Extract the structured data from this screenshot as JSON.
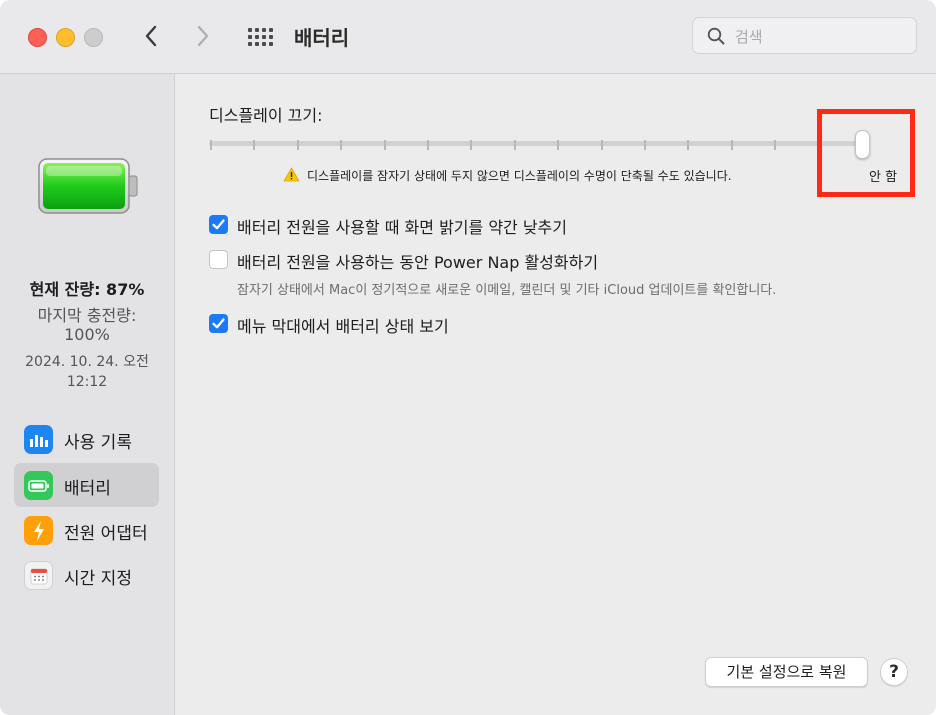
{
  "window": {
    "title": "배터리",
    "search_placeholder": "검색"
  },
  "sidebar": {
    "battery_level": {
      "current": "현재 잔량: 87%",
      "last_charged_label": "마지막 충전량:",
      "last_charged_value": "100%",
      "last_charged_date": "2024. 10. 24. 오전",
      "last_charged_time": "12:12"
    },
    "items": [
      {
        "label": "사용 기록",
        "icon": "bar-chart-icon",
        "color": "#1e86f2",
        "selected": false
      },
      {
        "label": "배터리",
        "icon": "battery-icon",
        "color": "#34c759",
        "selected": true
      },
      {
        "label": "전원 어댑터",
        "icon": "lightning-bolt-icon",
        "color": "#ff9f0a",
        "selected": false
      },
      {
        "label": "시간 지정",
        "icon": "calendar-icon",
        "color": "#f2f2f2",
        "selected": false
      }
    ]
  },
  "main": {
    "display_off_label": "디스플레이 끄기:",
    "slider_value_label": "안 함",
    "slider_position_fraction": 1.0,
    "warning_text": "디스플레이를 잠자기 상태에 두지 않으면 디스플레이의 수명이 단축될 수도 있습니다.",
    "options": [
      {
        "label": "배터리 전원을 사용할 때 화면 밝기를 약간 낮추기",
        "checked": true,
        "description": ""
      },
      {
        "label": "배터리 전원을 사용하는 동안 Power Nap 활성화하기",
        "checked": false,
        "description": "잠자기 상태에서 Mac이 정기적으로 새로운 이메일, 캘린더 및 기타 iCloud 업데이트를 확인합니다."
      },
      {
        "label": "메뉴 막대에서 배터리 상태 보기",
        "checked": true,
        "description": ""
      }
    ],
    "restore_button": "기본 설정으로 복원",
    "help_button": "?"
  },
  "colors": {
    "accent": "#1d7af6",
    "highlight": "#ff2a14",
    "battery_green": "#34c759"
  }
}
